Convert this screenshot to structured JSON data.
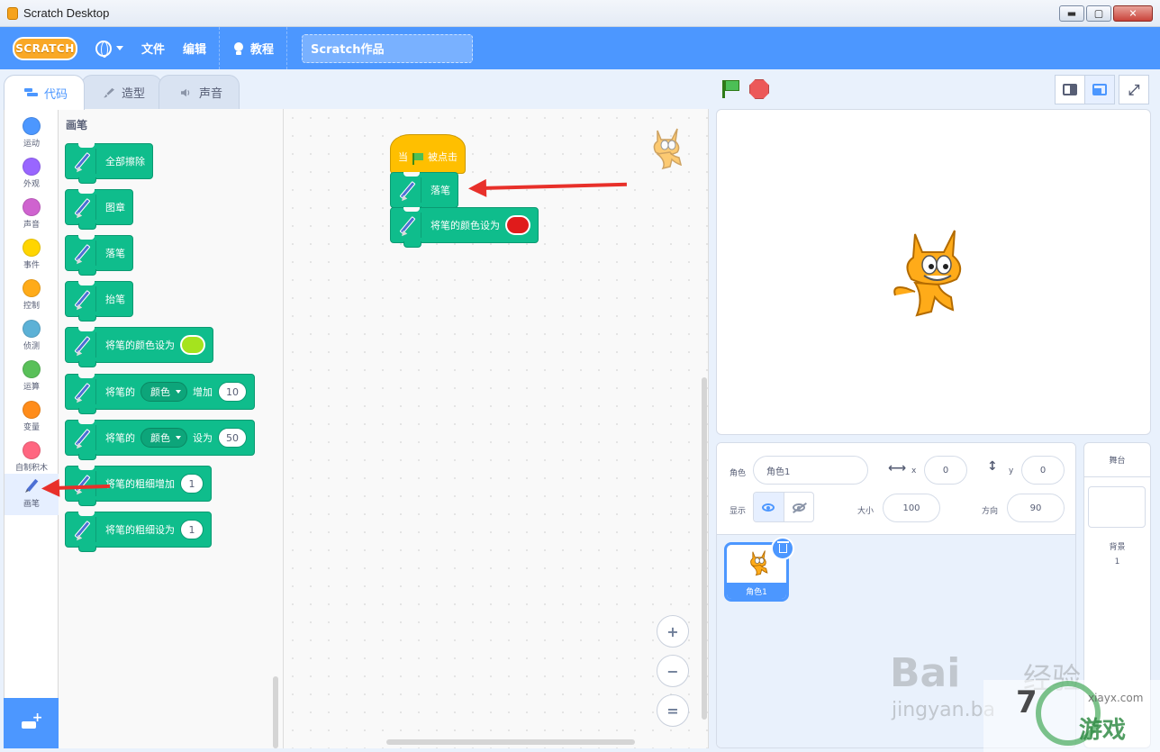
{
  "window": {
    "title": "Scratch Desktop",
    "controls": {
      "minimize": "▬",
      "maximize": "▢",
      "close": "✕"
    }
  },
  "menubar": {
    "logo": "SCRATCH",
    "file": "文件",
    "edit": "编辑",
    "tutorials": "教程",
    "project_title": "Scratch作品"
  },
  "tabs": [
    {
      "label": "代码",
      "active": true
    },
    {
      "label": "造型",
      "active": false
    },
    {
      "label": "声音",
      "active": false
    }
  ],
  "categories": [
    {
      "label": "运动",
      "color": "#4c97ff"
    },
    {
      "label": "外观",
      "color": "#9966ff"
    },
    {
      "label": "声音",
      "color": "#cf63cf"
    },
    {
      "label": "事件",
      "color": "#ffd500"
    },
    {
      "label": "控制",
      "color": "#ffab19"
    },
    {
      "label": "侦测",
      "color": "#5cb1d6"
    },
    {
      "label": "运算",
      "color": "#59c059"
    },
    {
      "label": "变量",
      "color": "#ff8c1a"
    },
    {
      "label": "自制积木",
      "color": "#ff6680"
    },
    {
      "label": "画笔",
      "color": "#0fbd8c"
    }
  ],
  "palette": {
    "title": "画笔",
    "blocks": {
      "erase_all": "全部擦除",
      "stamp": "图章",
      "pen_down": "落笔",
      "pen_up": "抬笔",
      "set_color": "将笔的颜色设为",
      "change_param_prefix": "将笔的",
      "change_param_dropdown": "颜色",
      "change_param_mid": "增加",
      "change_param_value": "10",
      "set_param_prefix": "将笔的",
      "set_param_dropdown": "颜色",
      "set_param_mid": "设为",
      "set_param_value": "50",
      "change_size": "将笔的粗细增加",
      "change_size_value": "1",
      "set_size": "将笔的粗细设为",
      "set_size_value": "1"
    },
    "swatch_color": "#a5e31e"
  },
  "script": {
    "hat_prefix": "当",
    "hat_suffix": "被点击",
    "pen_down": "落笔",
    "set_color": "将笔的颜色设为",
    "swatch_color": "#e01b1b"
  },
  "zoom": {
    "in": "+",
    "out": "−",
    "reset": "="
  },
  "stage_controls": {
    "fullscreen": "⤢"
  },
  "sprite_info": {
    "sprite_label": "角色",
    "sprite_name": "角色1",
    "x_label": "x",
    "x_value": "0",
    "y_label": "y",
    "y_value": "0",
    "show_label": "显示",
    "size_label": "大小",
    "size_value": "100",
    "direction_label": "方向",
    "direction_value": "90"
  },
  "sprite_list": [
    {
      "name": "角色1",
      "selected": true
    }
  ],
  "stage_pane": {
    "title": "舞台",
    "backdrops_label": "背景",
    "backdrops_count": "1"
  },
  "watermark": {
    "text1": "Bai",
    "text2": "经验",
    "text3": "jingyan.ba",
    "text4": "7",
    "text5": "游戏",
    "text6": "xiayx.com"
  }
}
